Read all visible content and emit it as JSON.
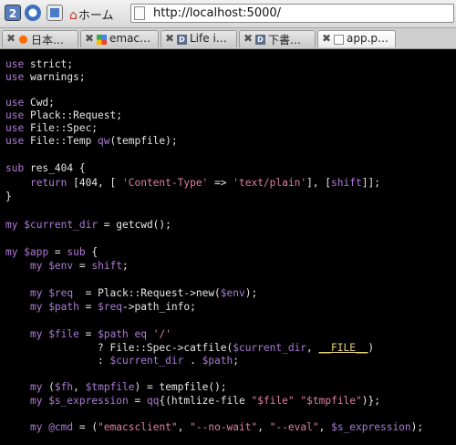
{
  "browser": {
    "toolbar": {
      "tab_count": "2",
      "home_label": "ホーム",
      "url": "http://localhost:5000/"
    },
    "tabs": [
      {
        "label": "日本…",
        "favicon": "red-circle-icon",
        "active": false
      },
      {
        "label": "emac…",
        "favicon": "google-icon",
        "active": false
      },
      {
        "label": "Life i…",
        "favicon": "d-icon",
        "active": false
      },
      {
        "label": "下書…",
        "favicon": "d-icon",
        "active": false
      },
      {
        "label": "app.p…",
        "favicon": "document-icon",
        "active": true
      }
    ]
  },
  "code": {
    "language": "perl",
    "lines": [
      "use strict;",
      "use warnings;",
      "",
      "use Cwd;",
      "use Plack::Request;",
      "use File::Spec;",
      "use File::Temp qw(tempfile);",
      "",
      "sub res_404 {",
      "    return [404, [ 'Content-Type' => 'text/plain'], [shift]];",
      "}",
      "",
      "my $current_dir = getcwd();",
      "",
      "my $app = sub {",
      "    my $env = shift;",
      "",
      "    my $req  = Plack::Request->new($env);",
      "    my $path = $req->path_info;",
      "",
      "    my $file = $path eq '/'",
      "               ? File::Spec->catfile($current_dir, __FILE__)",
      "               : $current_dir . $path;",
      "",
      "    my ($fh, $tmpfile) = tempfile();",
      "    my $s_expression = qq{(htmlize-file \"$file\" \"$tmpfile\")};",
      "",
      "    my @cmd = (\"emacsclient\", \"--no-wait\", \"--eval\", $s_expression);"
    ]
  },
  "colors": {
    "keyword": "#b37ad9",
    "variable": "#a97bd6",
    "string": "#e07fa2",
    "constant": "#e8d47a",
    "background": "#000000"
  }
}
